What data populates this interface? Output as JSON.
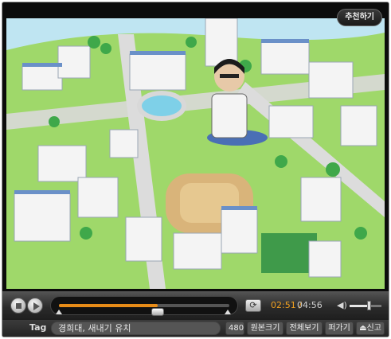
{
  "header": {
    "recommend_label": "추천하기"
  },
  "video": {
    "thumbnail": "campus-illustration"
  },
  "controls": {
    "stop_icon": "stop-icon",
    "play_icon": "play-icon",
    "progress": 0.58,
    "repeat_icon": "repeat-icon",
    "time_current": "02:51",
    "time_separator": "/",
    "time_total": "04:56",
    "volume_icon": "speaker-icon",
    "volume_level": 0.6
  },
  "tag_bar": {
    "tag_label": "Tag",
    "tag_value": "경희대, 새내기 유치",
    "quality_label": "480",
    "original_size_label": "원본크기",
    "fullscreen_label": "전체보기",
    "scrap_label": "퍼가기",
    "report_label": "신고",
    "report_icon": "report-icon"
  },
  "colors": {
    "accent": "#f0a020",
    "player_bg": "#0c0c0c",
    "control_bg": "#2b2b2b"
  }
}
